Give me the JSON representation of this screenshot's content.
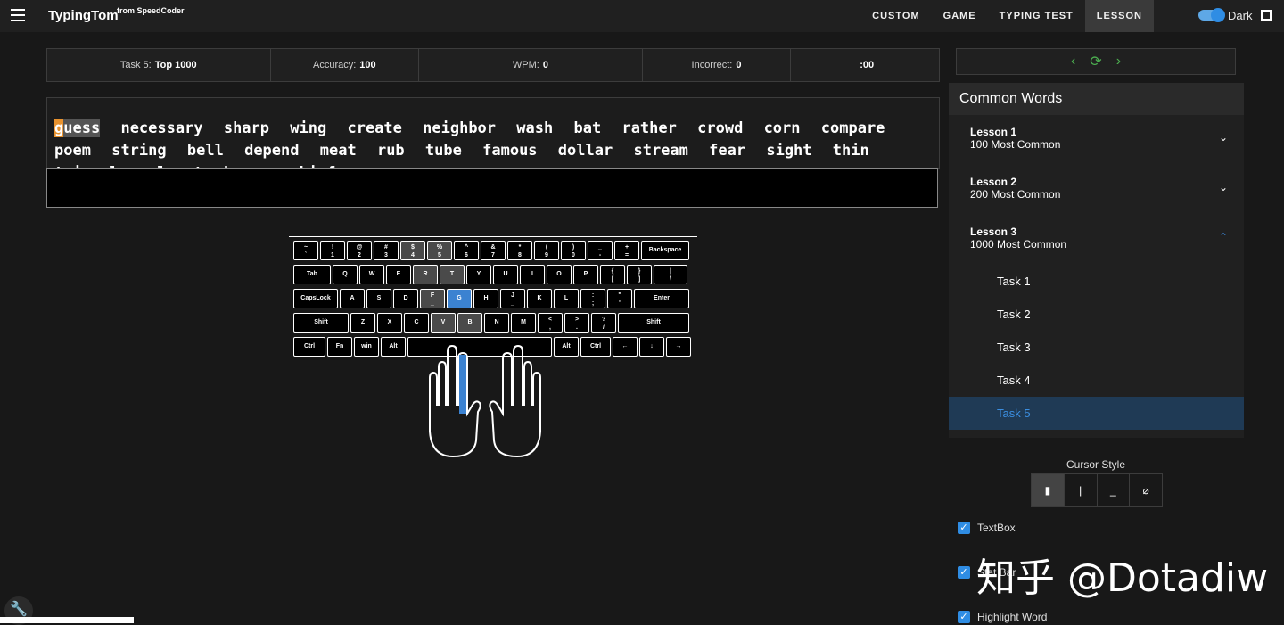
{
  "header": {
    "brand": "TypingTom",
    "brand_sub": "from SpeedCoder",
    "nav": [
      "CUSTOM",
      "GAME",
      "TYPING TEST",
      "LESSON"
    ],
    "active_nav": "LESSON",
    "dark_label": "Dark"
  },
  "stats": {
    "task_label": "Task 5:",
    "task_value": "Top 1000",
    "accuracy_label": "Accuracy:",
    "accuracy_value": "100",
    "wpm_label": "WPM:",
    "wpm_value": "0",
    "incorrect_label": "Incorrect:",
    "incorrect_value": "0",
    "timer": ":00"
  },
  "practice": {
    "current_first_letter": "g",
    "current_rest": "uess",
    "words": [
      "necessary",
      "sharp",
      "wing",
      "create",
      "neighbor",
      "wash",
      "bat",
      "rather",
      "crowd",
      "corn",
      "compare",
      "poem",
      "string",
      "bell",
      "depend",
      "meat",
      "rub",
      "tube",
      "famous",
      "dollar",
      "stream",
      "fear",
      "sight",
      "thin",
      "triangle",
      "planet",
      "hurry",
      "chief"
    ]
  },
  "keyboard": {
    "row1": [
      [
        "~",
        "`"
      ],
      [
        "!",
        "1"
      ],
      [
        "@",
        "2"
      ],
      [
        "#",
        "3"
      ],
      [
        "$",
        "4"
      ],
      [
        "%",
        "5"
      ],
      [
        "^",
        "6"
      ],
      [
        "&",
        "7"
      ],
      [
        "*",
        "8"
      ],
      [
        "(",
        "9"
      ],
      [
        ")",
        "0"
      ],
      [
        "_",
        "-"
      ],
      [
        "+",
        "="
      ],
      [
        "Backspace",
        ""
      ]
    ],
    "row2": [
      [
        "Tab",
        ""
      ],
      [
        "Q",
        ""
      ],
      [
        "W",
        ""
      ],
      [
        "E",
        ""
      ],
      [
        "R",
        ""
      ],
      [
        "T",
        ""
      ],
      [
        "Y",
        ""
      ],
      [
        "U",
        ""
      ],
      [
        "I",
        ""
      ],
      [
        "O",
        ""
      ],
      [
        "P",
        ""
      ],
      [
        "{",
        "["
      ],
      [
        "}",
        "]"
      ],
      [
        "|",
        "\\"
      ]
    ],
    "row3": [
      [
        "CapsLock",
        ""
      ],
      [
        "A",
        ""
      ],
      [
        "S",
        ""
      ],
      [
        "D",
        ""
      ],
      [
        "F",
        "_"
      ],
      [
        "G",
        ""
      ],
      [
        "H",
        ""
      ],
      [
        "J",
        "_"
      ],
      [
        "K",
        ""
      ],
      [
        "L",
        ""
      ],
      [
        ":",
        ";"
      ],
      [
        "\"",
        "'"
      ],
      [
        "Enter",
        ""
      ]
    ],
    "row4": [
      [
        "Shift",
        ""
      ],
      [
        "Z",
        ""
      ],
      [
        "X",
        ""
      ],
      [
        "C",
        ""
      ],
      [
        "V",
        ""
      ],
      [
        "B",
        ""
      ],
      [
        "N",
        ""
      ],
      [
        "M",
        ""
      ],
      [
        "<",
        ","
      ],
      [
        ">",
        "."
      ],
      [
        "?",
        "/"
      ],
      [
        "Shift",
        ""
      ]
    ],
    "row5": [
      [
        "Ctrl",
        ""
      ],
      [
        "Fn",
        ""
      ],
      [
        "win",
        ""
      ],
      [
        "Alt",
        ""
      ],
      [
        "",
        ""
      ],
      [
        "Alt",
        ""
      ],
      [
        "Ctrl",
        ""
      ],
      [
        "←",
        ""
      ],
      [
        "↓",
        ""
      ],
      [
        "→",
        ""
      ]
    ],
    "target_key": "G"
  },
  "sidebar": {
    "nav_prev": "‹",
    "nav_refresh": "⟳",
    "nav_next": "›",
    "title": "Common Words",
    "lessons": [
      {
        "name": "Lesson 1",
        "desc": "100 Most Common"
      },
      {
        "name": "Lesson 2",
        "desc": "200 Most Common"
      },
      {
        "name": "Lesson 3",
        "desc": "1000 Most Common"
      }
    ],
    "tasks": [
      "Task 1",
      "Task 2",
      "Task 3",
      "Task 4",
      "Task 5"
    ],
    "active_task": "Task 5"
  },
  "settings": {
    "cursor_style_label": "Cursor Style",
    "cursor_options": [
      "▮",
      "|",
      "_",
      "⌀"
    ],
    "checkboxes": [
      "TextBox",
      "Stat Bar",
      "Highlight Word"
    ]
  },
  "watermark": "知乎 @Dotadiw"
}
